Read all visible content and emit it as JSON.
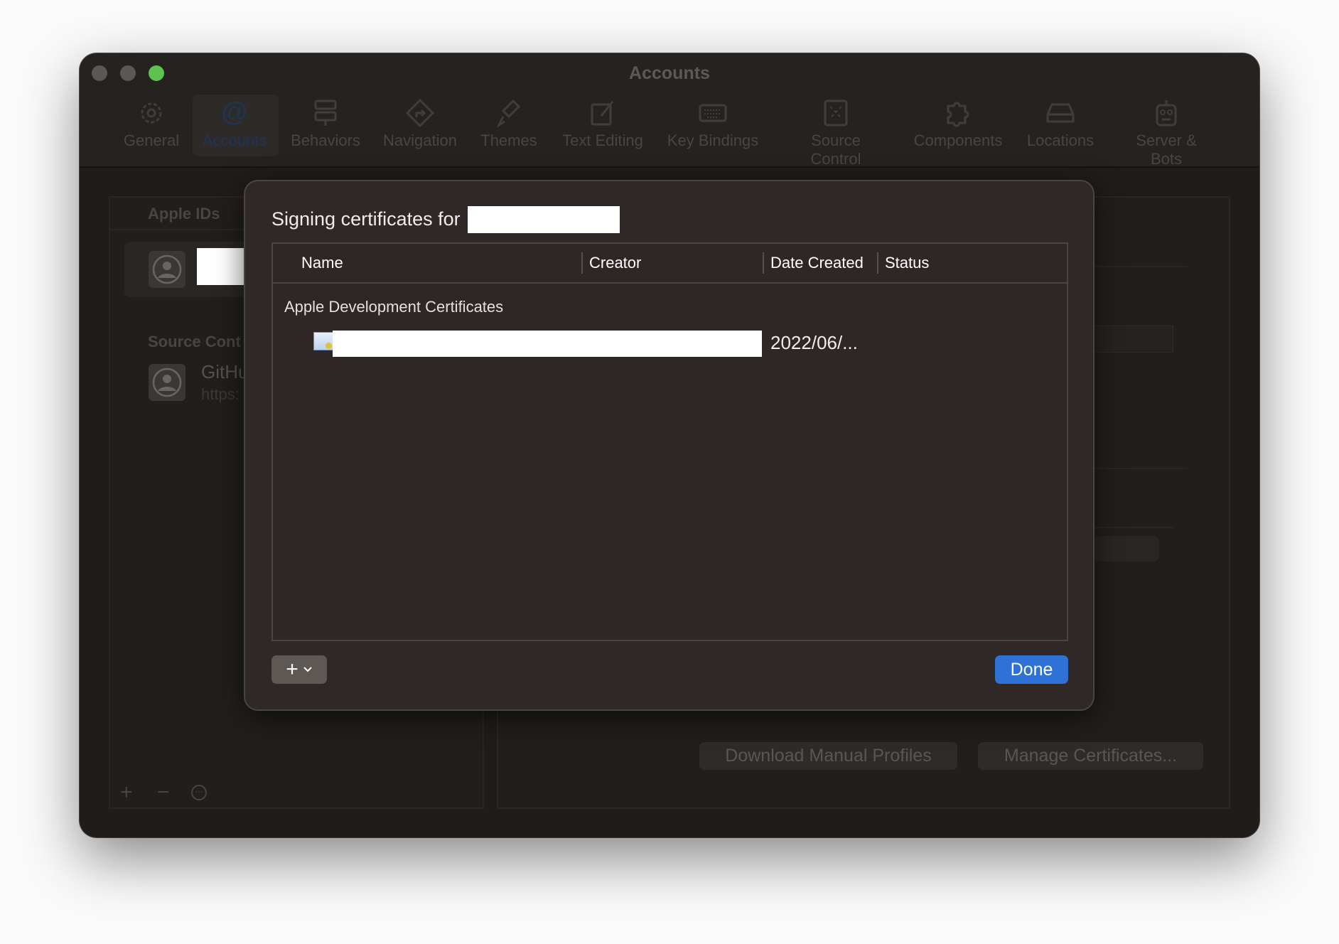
{
  "window": {
    "title": "Accounts",
    "traffic_lights": {
      "close": "#5b5756",
      "minimize": "#5b5756",
      "zoom": "#5ec24f"
    }
  },
  "toolbar": {
    "items": [
      {
        "label": "General",
        "icon": "gear-icon"
      },
      {
        "label": "Accounts",
        "icon": "at-icon",
        "selected": true
      },
      {
        "label": "Behaviors",
        "icon": "behaviors-icon"
      },
      {
        "label": "Navigation",
        "icon": "navigation-icon"
      },
      {
        "label": "Themes",
        "icon": "brush-icon"
      },
      {
        "label": "Text Editing",
        "icon": "pencil-square-icon"
      },
      {
        "label": "Key Bindings",
        "icon": "keyboard-icon"
      },
      {
        "label": "Source Control",
        "icon": "source-control-icon"
      },
      {
        "label": "Components",
        "icon": "puzzle-icon"
      },
      {
        "label": "Locations",
        "icon": "drive-icon"
      },
      {
        "label": "Server & Bots",
        "icon": "robot-icon"
      }
    ]
  },
  "sidebar": {
    "apple_ids_header": "Apple IDs",
    "source_control_header": "Source Cont",
    "github_name": "GitHu",
    "github_url": "https:",
    "footer": {
      "add": "+",
      "remove": "−",
      "more": "⋯"
    }
  },
  "main": {
    "download_profiles": "Download Manual Profiles",
    "manage_certificates": "Manage Certificates..."
  },
  "dialog": {
    "title": "Signing certificates for",
    "columns": [
      "Name",
      "Creator",
      "Date Created",
      "Status"
    ],
    "group": "Apple Development Certificates",
    "rows": [
      {
        "date_created": "2022/06/..."
      }
    ],
    "add_button": "+",
    "done_button": "Done",
    "accent": "#2f72d6"
  }
}
